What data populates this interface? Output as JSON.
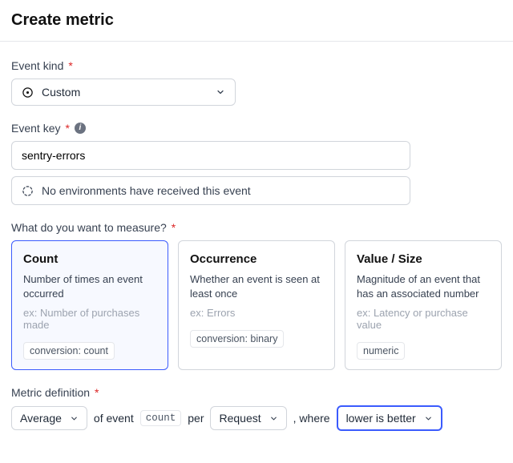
{
  "title": "Create metric",
  "eventKind": {
    "label": "Event kind",
    "value": "Custom"
  },
  "eventKey": {
    "label": "Event key",
    "value": "sentry-errors",
    "status": "No environments have received this event"
  },
  "measure": {
    "label": "What do you want to measure?",
    "options": [
      {
        "title": "Count",
        "desc": "Number of times an event occurred",
        "example": "ex: Number of purchases made",
        "tag": "conversion: count"
      },
      {
        "title": "Occurrence",
        "desc": "Whether an event is seen at least once",
        "example": "ex: Errors",
        "tag": "conversion: binary"
      },
      {
        "title": "Value / Size",
        "desc": "Magnitude of an event that has an associated number",
        "example": "ex: Latency or purchase value",
        "tag": "numeric"
      }
    ]
  },
  "definition": {
    "label": "Metric definition",
    "agg": "Average",
    "text_of_event": "of event",
    "count_token": "count",
    "text_per": "per",
    "unit": "Request",
    "text_where": ", where",
    "direction": "lower is better"
  }
}
